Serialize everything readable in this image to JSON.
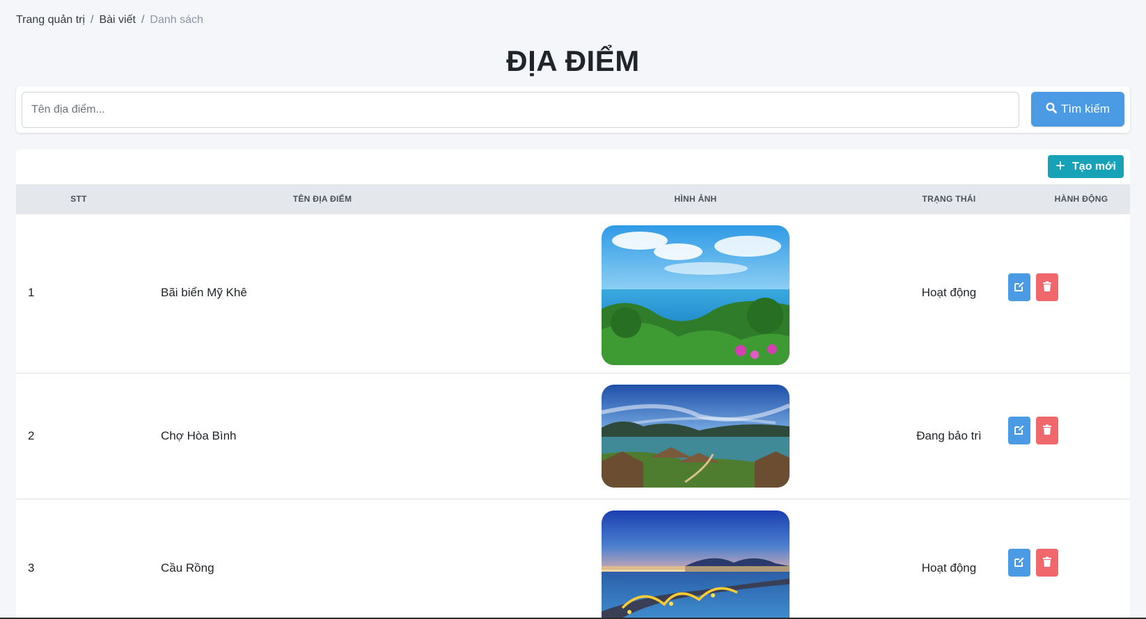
{
  "breadcrumb": {
    "items": [
      "Trang quản trị",
      "Bài viết"
    ],
    "current": "Danh sách",
    "separator": "/"
  },
  "page": {
    "title": "ĐỊA ĐIỂM"
  },
  "search": {
    "placeholder": "Tên địa điểm...",
    "value": "",
    "button_label": "Tìm kiếm",
    "button_icon": "search-icon"
  },
  "toolbar": {
    "create_label": "Tạo mới",
    "create_icon": "plus-icon"
  },
  "table": {
    "columns": [
      "STT",
      "TÊN ĐỊA ĐIỂM",
      "HÌNH ẢNH",
      "TRẠNG THÁI",
      "HÀNH ĐỘNG"
    ],
    "rows": [
      {
        "stt": "1",
        "name": "Bãi biển Mỹ Khê",
        "image": "coastal-hill-photo",
        "status": "Hoạt động"
      },
      {
        "stt": "2",
        "name": "Chợ Hòa Bình",
        "image": "lake-resort-photo",
        "status": "Đang bảo trì"
      },
      {
        "stt": "3",
        "name": "Cầu Rồng",
        "image": "dragon-bridge-night-photo",
        "status": "Hoạt động"
      }
    ],
    "action_icons": [
      "edit-icon",
      "trash-icon"
    ]
  },
  "colors": {
    "primary": "#4a9be3",
    "info": "#17a2b8",
    "danger": "#f0686b",
    "header_bg": "#e4e7eb",
    "page_bg": "#f4f6f9"
  }
}
